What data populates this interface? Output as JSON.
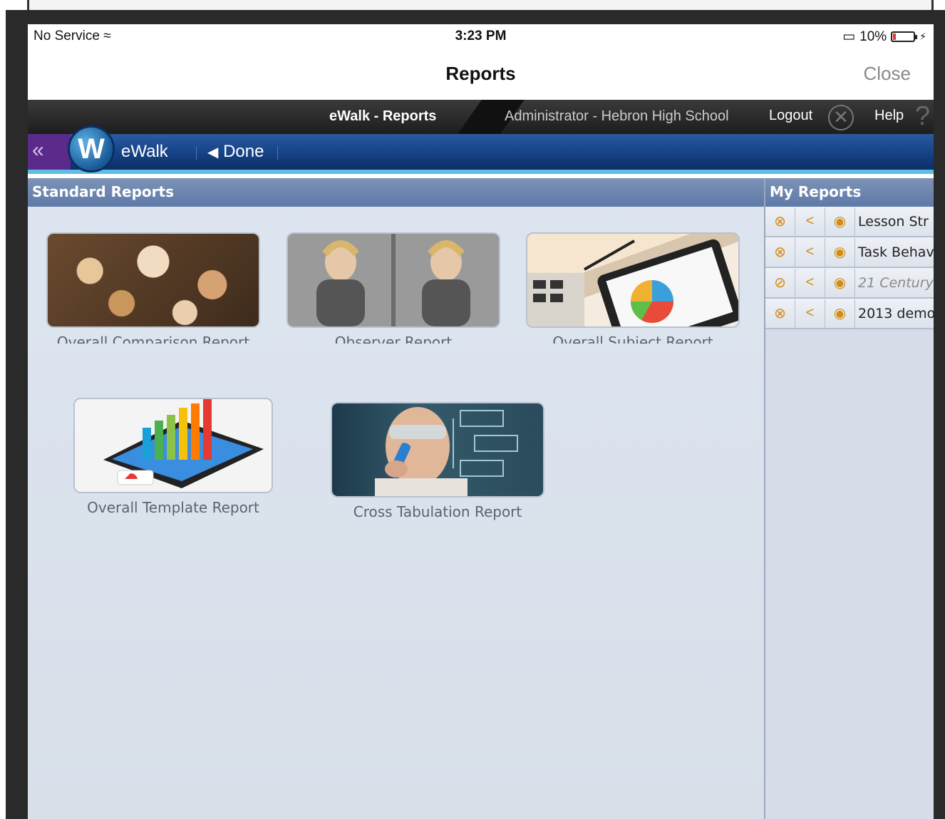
{
  "status_bar": {
    "carrier": "No Service",
    "wifi_icon": "wifi-icon",
    "time": "3:23 PM",
    "battery_text": "10%"
  },
  "nav_bar": {
    "title": "Reports",
    "close_label": "Close"
  },
  "app_header": {
    "breadcrumb": "eWalk - Reports",
    "organization": "Administrator - Hebron High School",
    "logout_label": "Logout",
    "help_label": "Help"
  },
  "toolbar": {
    "collapse_glyph": "«",
    "logo_letter": "W",
    "app_name": "eWalk",
    "done_label": "Done"
  },
  "standard_reports": {
    "heading": "Standard Reports",
    "tiles": [
      {
        "label": "Overall Comparison Report"
      },
      {
        "label": "Observer Report"
      },
      {
        "label": "Overall Subject Report"
      },
      {
        "label": "Overall Template Report"
      },
      {
        "label": "Cross Tabulation Report"
      }
    ]
  },
  "my_reports": {
    "heading": "My Reports",
    "items": [
      {
        "title": "Lesson Str",
        "italic": false
      },
      {
        "title": "Task Behav",
        "italic": false
      },
      {
        "title": "21 Century",
        "italic": true
      },
      {
        "title": "2013 demo",
        "italic": false
      }
    ]
  }
}
